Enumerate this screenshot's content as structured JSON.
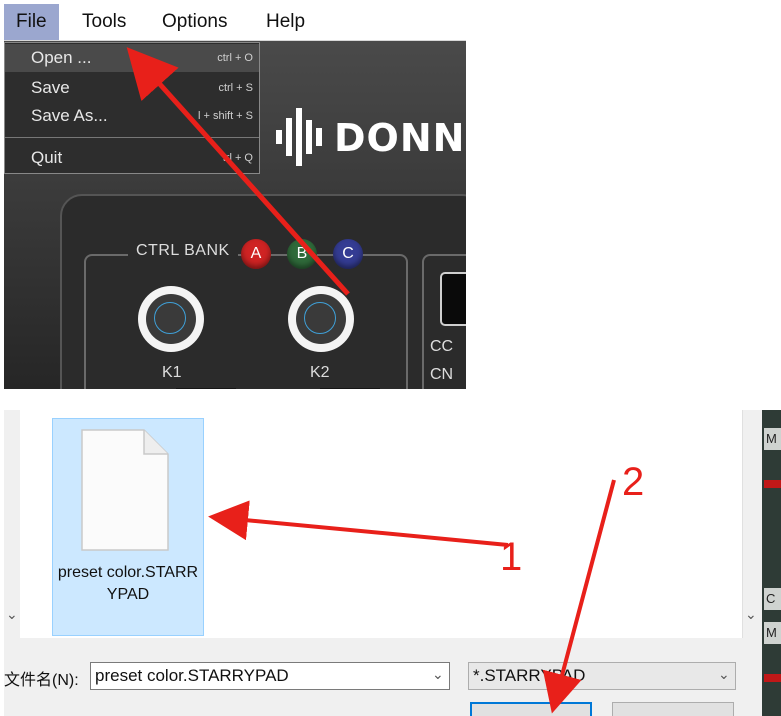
{
  "app": {
    "menu": [
      "File",
      "Tools",
      "Options",
      "Help"
    ],
    "file_menu": [
      {
        "label": "Open ...",
        "shortcut": "ctrl + O"
      },
      {
        "label": "Save",
        "shortcut": "ctrl + S"
      },
      {
        "label": "Save As...",
        "shortcut": "l + shift + S"
      },
      {
        "label": "Quit",
        "shortcut": "trl + Q"
      }
    ],
    "brand": "DONNE",
    "ctrl_bank": {
      "label": "CTRL BANK",
      "buttons": [
        "A",
        "B",
        "C"
      ],
      "colors": {
        "A": "#cf2323",
        "B": "#2f6a3a",
        "C": "#343c93"
      }
    },
    "knobs": [
      "K1",
      "K2"
    ],
    "right_labels": [
      "CC",
      "CN"
    ]
  },
  "dialog": {
    "file": {
      "name": "preset color.STARRYPAD",
      "icon": "document-icon"
    },
    "filename_label": "文件名(N):",
    "filename_value": "preset color.STARRYPAD",
    "filter_value": "*.STARRYPAD",
    "side_labels": [
      "M",
      "C",
      "M"
    ]
  },
  "annotations": {
    "step1": "1",
    "step2": "2",
    "arrow_color": "#e8201a"
  }
}
